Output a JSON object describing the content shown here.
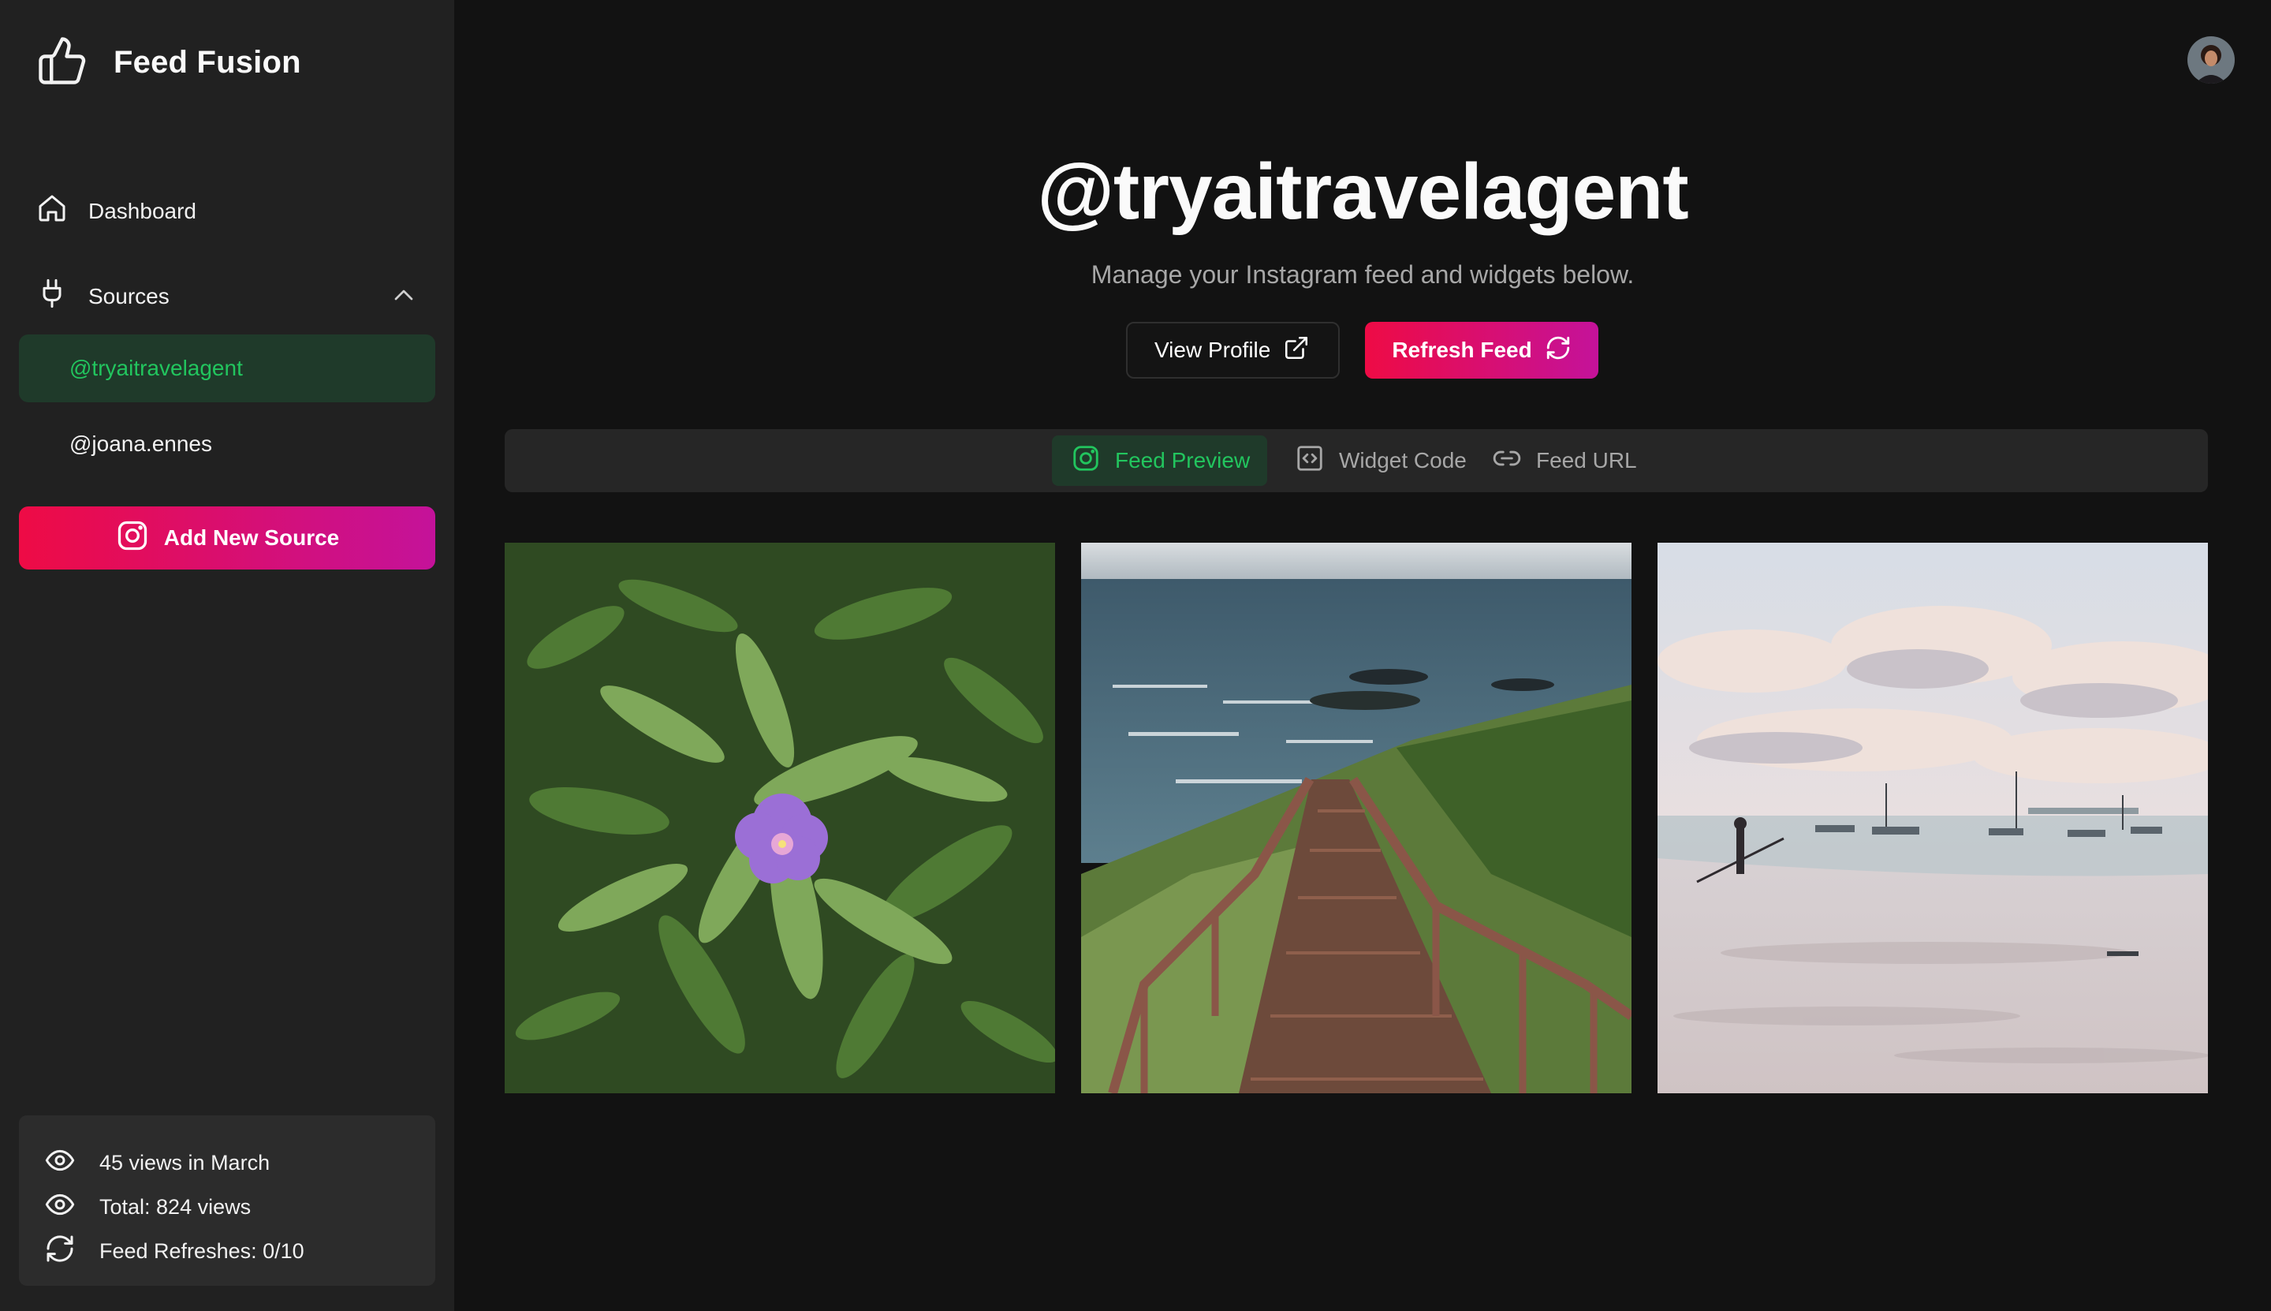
{
  "app": {
    "name": "Feed Fusion"
  },
  "sidebar": {
    "nav": [
      {
        "label": "Dashboard",
        "icon": "home-icon"
      },
      {
        "label": "Sources",
        "icon": "plug-icon"
      }
    ],
    "sources": [
      {
        "label": "@tryaitravelagent",
        "active": true
      },
      {
        "label": "@joana.ennes",
        "active": false
      }
    ],
    "add_source_label": "Add New Source",
    "stats": [
      {
        "label": "45 views in March",
        "icon": "eye-icon"
      },
      {
        "label": "Total: 824 views",
        "icon": "eye-icon"
      },
      {
        "label": "Feed Refreshes: 0/10",
        "icon": "refresh-icon"
      }
    ]
  },
  "main": {
    "title": "@tryaitravelagent",
    "subtitle": "Manage your Instagram feed and widgets below.",
    "view_profile_label": "View Profile",
    "refresh_label": "Refresh Feed",
    "tabs": [
      {
        "label": "Feed Preview",
        "icon": "instagram-icon",
        "active": true
      },
      {
        "label": "Widget Code",
        "icon": "code-icon",
        "active": false
      },
      {
        "label": "Feed URL",
        "icon": "link-icon",
        "active": false
      }
    ],
    "feed": [
      {
        "subject": "purple flower among green leaves"
      },
      {
        "subject": "wooden stairway down to rocky ocean coast"
      },
      {
        "subject": "beach at low tide with boats and a person fishing"
      }
    ]
  },
  "colors": {
    "accent_green": "#22c55e",
    "gradient_start": "#ee0b45",
    "gradient_end": "#c4129a",
    "background": "#121212",
    "sidebar": "#212121"
  }
}
